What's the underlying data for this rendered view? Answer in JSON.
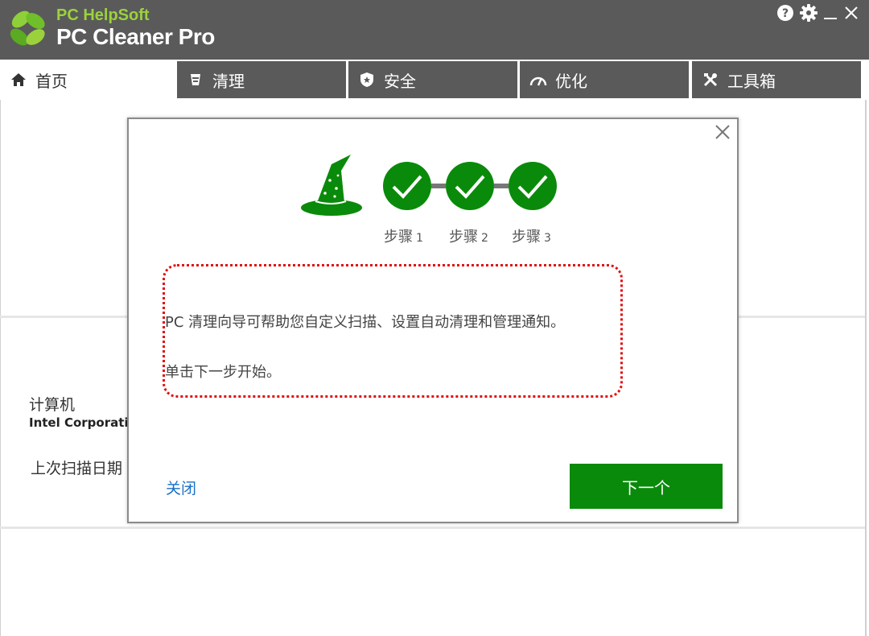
{
  "app": {
    "brand_top": "PC HelpSoft",
    "brand_main": "PC Cleaner Pro",
    "accent_color": "#0a8a0a",
    "titlebar_color": "#5a5a5a"
  },
  "window_controls": {
    "help_icon": "question-circle-icon",
    "settings_icon": "gear-icon",
    "minimize_icon": "minimize-icon",
    "close_icon": "close-icon"
  },
  "tabs": [
    {
      "label": "首页",
      "icon": "home-icon",
      "active": true
    },
    {
      "label": "清理",
      "icon": "broom-icon",
      "active": false
    },
    {
      "label": "安全",
      "icon": "shield-icon",
      "active": false
    },
    {
      "label": "优化",
      "icon": "speedometer-icon",
      "active": false
    },
    {
      "label": "工具箱",
      "icon": "tools-icon",
      "active": false
    }
  ],
  "background": {
    "computer_label": "计算机",
    "computer_value": "Intel Corporatio",
    "last_scan_label": "上次扫描日期"
  },
  "wizard": {
    "steps": [
      {
        "label": "步骤",
        "num": "1",
        "status": "complete"
      },
      {
        "label": "步骤",
        "num": "2",
        "status": "complete"
      },
      {
        "label": "步骤",
        "num": "3",
        "status": "complete"
      }
    ],
    "message_line1": "PC 清理向导可帮助您自定义扫描、设置自动清理和管理通知。",
    "message_line2": "单击下一步开始。",
    "close_label": "关闭",
    "next_label": "下一个"
  }
}
